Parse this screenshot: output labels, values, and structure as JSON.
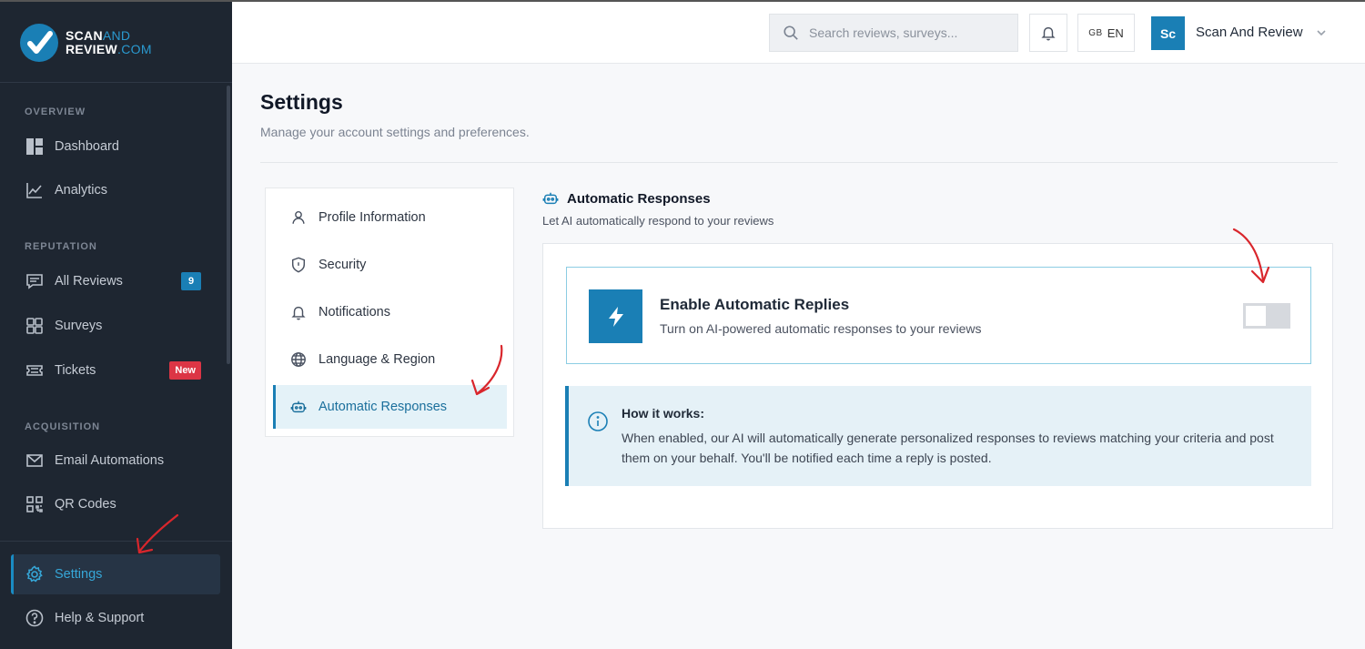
{
  "brand": {
    "line1": "SCAN",
    "line1_light": "AND",
    "line2": "REVIEW",
    "line2_light": ".COM"
  },
  "sidebar": {
    "sections": {
      "overview": "OVERVIEW",
      "reputation": "REPUTATION",
      "acquisition": "ACQUISITION"
    },
    "items": [
      {
        "label": "Dashboard",
        "icon": "dashboard-icon"
      },
      {
        "label": "Analytics",
        "icon": "analytics-icon"
      },
      {
        "label": "All Reviews",
        "icon": "reviews-icon",
        "badge": "9"
      },
      {
        "label": "Surveys",
        "icon": "surveys-icon"
      },
      {
        "label": "Tickets",
        "icon": "ticket-icon",
        "badge": "New"
      },
      {
        "label": "Email Automations",
        "icon": "mail-icon"
      },
      {
        "label": "QR Codes",
        "icon": "qr-code-icon"
      },
      {
        "label": "Settings",
        "icon": "gear-icon",
        "active": true
      },
      {
        "label": "Help & Support",
        "icon": "help-icon"
      }
    ]
  },
  "header": {
    "search_placeholder": "Search reviews, surveys...",
    "lang_flag": "GB",
    "lang_code": "EN",
    "avatar_initials": "Sc",
    "user_name": "Scan And Review"
  },
  "page": {
    "title": "Settings",
    "subtitle": "Manage your account settings and preferences."
  },
  "settings_nav": [
    {
      "label": "Profile Information",
      "icon": "user-icon"
    },
    {
      "label": "Security",
      "icon": "shield-icon"
    },
    {
      "label": "Notifications",
      "icon": "bell-icon"
    },
    {
      "label": "Language & Region",
      "icon": "globe-icon"
    },
    {
      "label": "Automatic Responses",
      "icon": "robot-icon",
      "active": true
    }
  ],
  "auto_responses": {
    "title": "Automatic Responses",
    "subtitle": "Let AI automatically respond to your reviews",
    "toggle_title": "Enable Automatic Replies",
    "toggle_subtitle": "Turn on AI-powered automatic responses to your reviews",
    "toggle_enabled": false,
    "info_title": "How it works:",
    "info_text": "When enabled, our AI will automatically generate personalized responses to reviews matching your criteria and post them on your behalf. You'll be notified each time a reply is posted."
  },
  "colors": {
    "sidebar_bg": "#1e2631",
    "accent": "#1a7fb5",
    "badge_red": "#dc3545",
    "annotation_red": "#d9262c"
  }
}
